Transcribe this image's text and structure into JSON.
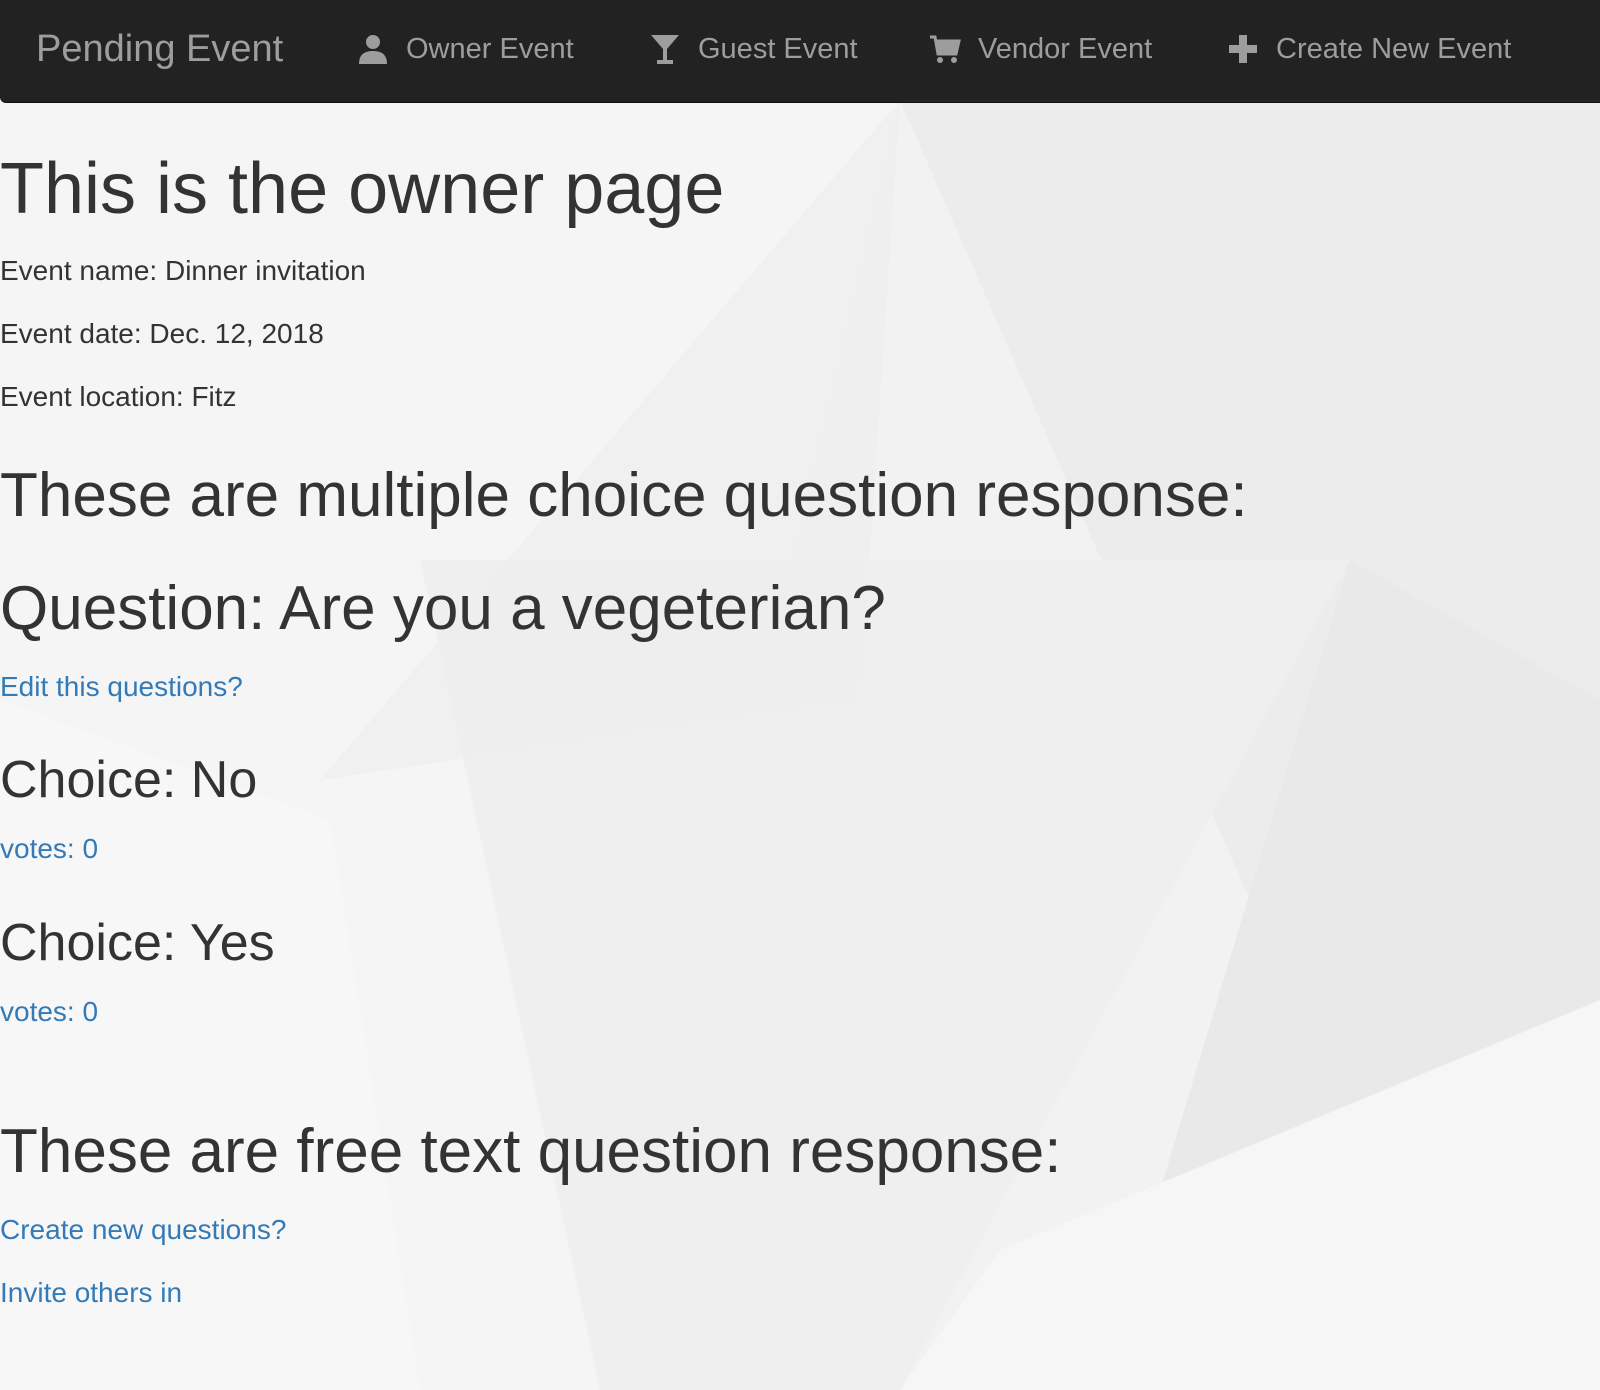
{
  "navbar": {
    "brand": "Pending Event",
    "items": [
      {
        "label": "Owner Event",
        "icon": "user-icon"
      },
      {
        "label": "Guest Event",
        "icon": "cocktail-glass-icon"
      },
      {
        "label": "Vendor Event",
        "icon": "shopping-cart-icon"
      },
      {
        "label": "Create New Event",
        "icon": "plus-icon"
      }
    ],
    "colors": {
      "background": "#222222",
      "text": "#9d9d9d"
    }
  },
  "main": {
    "page_title": "This is the owner page",
    "event": {
      "name": "Event name: Dinner invitation",
      "date": "Event date: Dec. 12, 2018",
      "location": "Event location: Fitz"
    },
    "mc_heading": "These are multiple choice question response:",
    "question": "Question: Are you a vegeterian?",
    "edit_link": "Edit this questions?",
    "choices": [
      {
        "label": "Choice: No",
        "votes": "votes: 0"
      },
      {
        "label": "Choice: Yes",
        "votes": "votes: 0"
      }
    ],
    "free_text_heading": "These are free text question response:",
    "create_link": "Create new questions?",
    "invite_link": "Invite others in",
    "colors": {
      "text": "#333333",
      "link": "#337ab7"
    }
  }
}
